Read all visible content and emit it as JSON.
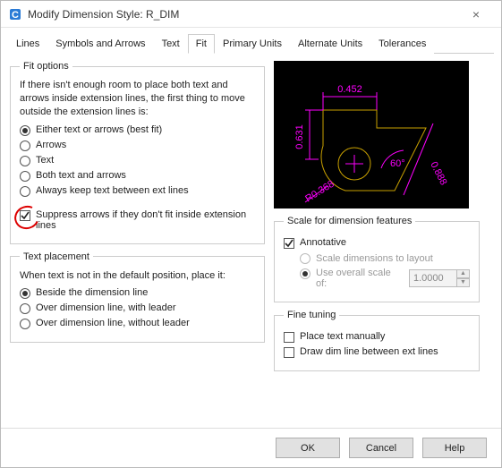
{
  "window": {
    "title": "Modify Dimension Style: R_DIM"
  },
  "tabs": {
    "items": [
      {
        "label": "Lines"
      },
      {
        "label": "Symbols and Arrows"
      },
      {
        "label": "Text"
      },
      {
        "label": "Fit"
      },
      {
        "label": "Primary Units"
      },
      {
        "label": "Alternate Units"
      },
      {
        "label": "Tolerances"
      }
    ],
    "active_index": 3
  },
  "fit_options": {
    "legend": "Fit options",
    "intro": "If there isn't enough room to place both text and arrows inside extension lines, the first thing to move outside the extension lines is:",
    "radios": [
      {
        "label": "Either text or arrows (best fit)",
        "checked": true
      },
      {
        "label": "Arrows",
        "checked": false
      },
      {
        "label": "Text",
        "checked": false
      },
      {
        "label": "Both text and arrows",
        "checked": false
      },
      {
        "label": "Always keep text between ext lines",
        "checked": false
      }
    ],
    "suppress": {
      "label": "Suppress arrows if they don't fit inside extension lines",
      "checked": true
    }
  },
  "text_placement": {
    "legend": "Text placement",
    "intro": "When text is not in the default position, place it:",
    "radios": [
      {
        "label": "Beside the dimension line",
        "checked": true
      },
      {
        "label": "Over dimension line, with leader",
        "checked": false
      },
      {
        "label": "Over dimension line, without leader",
        "checked": false
      }
    ]
  },
  "preview_dims": {
    "top": "0.452",
    "left": "0.631",
    "diag": "0.888",
    "angle": "60°",
    "radius": "R0.368"
  },
  "scale": {
    "legend": "Scale for dimension features",
    "annotative": {
      "label": "Annotative",
      "checked": true
    },
    "scale_to_layout": {
      "label": "Scale dimensions to layout",
      "checked": false,
      "enabled": false
    },
    "overall": {
      "label": "Use overall scale of:",
      "checked": true,
      "enabled": false,
      "value": "1.0000"
    }
  },
  "fine_tuning": {
    "legend": "Fine tuning",
    "place_manual": {
      "label": "Place text manually",
      "checked": false
    },
    "draw_dim": {
      "label": "Draw dim line between ext lines",
      "checked": false
    }
  },
  "buttons": {
    "ok": "OK",
    "cancel": "Cancel",
    "help": "Help"
  }
}
